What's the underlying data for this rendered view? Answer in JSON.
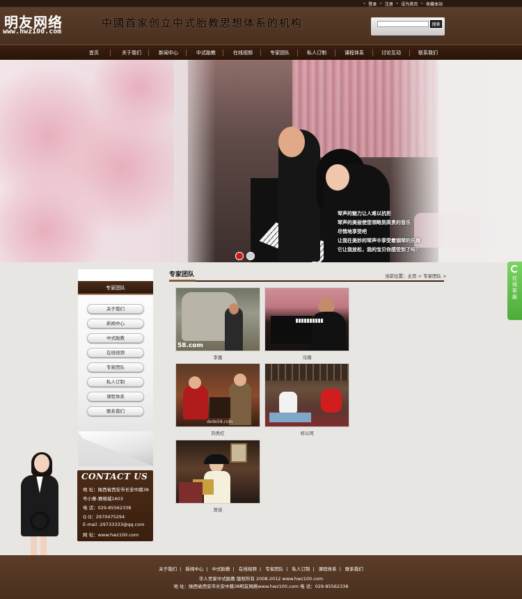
{
  "topbar": {
    "links": [
      "登录",
      "注册",
      "设为首页",
      "收藏本站"
    ]
  },
  "header": {
    "logo_text": "明友网络",
    "logo_url": "www.hwz100.com",
    "slogan": "中國首家创立中式胎教思想体系的机构",
    "search_placeholder": "",
    "search_button": "搜索"
  },
  "nav": {
    "items": [
      "首页",
      "关于我们",
      "新闻中心",
      "中式胎教",
      "在线视频",
      "专家团队",
      "私人订制",
      "课程体系",
      "讨论互动",
      "联系我们"
    ]
  },
  "banner": {
    "poem_lines": [
      "琴声的魅力让人难以抗拒",
      "琴声的美丽使您领略到高贵的音乐",
      "尽情地享受吧",
      "让我在美妙的琴声中享受着钢琴的乐趣",
      "它让我放松，我的宝贝你感受到了吗？"
    ],
    "slide_count": 2,
    "active_slide": 0
  },
  "sidebar": {
    "title": "专家团队",
    "items": [
      "关于我们",
      "新闻中心",
      "中式胎教",
      "在线视频",
      "专家团队",
      "私人订制",
      "课程体系",
      "联系我们"
    ]
  },
  "contact": {
    "title": "CONTACT US",
    "lines": [
      "地  址：陕西省西安市长安中路38",
      "号小寨-赛格城1603",
      "电  话：029-85562338",
      "Q  Q：2970475294",
      "E-mail :29733333@qq.com",
      "网  址：www.hwz100.com"
    ]
  },
  "main": {
    "title": "专家团队",
    "breadcrumb": "当前位置：主页 > 专家团队 >",
    "experts": [
      {
        "name": "李嘉",
        "watermark": "58.com"
      },
      {
        "name": "马璐",
        "watermark": ""
      },
      {
        "name": "刘秀红",
        "watermark": "dede58.com"
      },
      {
        "name": "祁以珂",
        "watermark": ""
      },
      {
        "name": "贾佳",
        "watermark": ""
      }
    ]
  },
  "service_tab": {
    "label": [
      "在",
      "线",
      "客",
      "服"
    ]
  },
  "footer": {
    "links": [
      "关于我们",
      "新闻中心",
      "中式胎教",
      "在线视频",
      "专家团队",
      "私人订制",
      "课程体系",
      "联系我们"
    ],
    "copyright": "华人世家中式胎教 版权所有 2008-2012 www.hwz100.com",
    "address": "地 址：陕西省西安市长安中路38明友网络www.hwz100.com 电 话：029-85562338"
  },
  "colors": {
    "brand_brown": "#4a2c18",
    "service_green": "#5cbd45",
    "slide_active": "#d01a1a"
  }
}
